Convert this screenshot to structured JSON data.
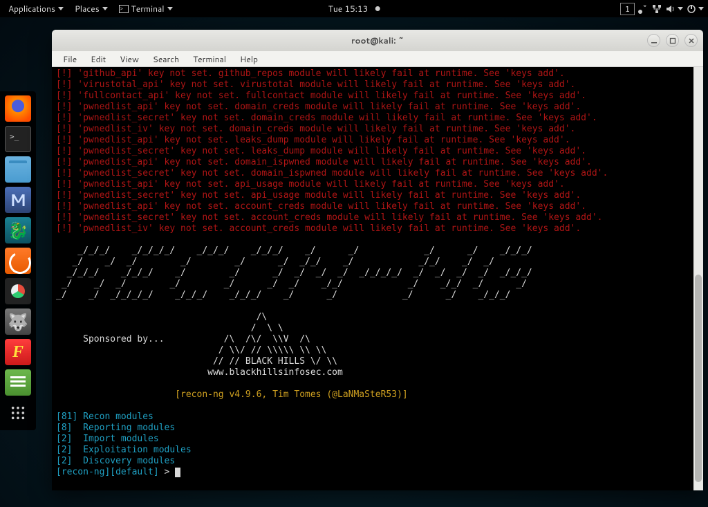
{
  "topbar": {
    "applications": "Applications",
    "places": "Places",
    "terminal_app": "Terminal",
    "clock": "Tue 15:13",
    "workspace": "1"
  },
  "window": {
    "title": "root@kali: ~",
    "menus": {
      "file": "File",
      "edit": "Edit",
      "view": "View",
      "search": "Search",
      "terminal": "Terminal",
      "help": "Help"
    }
  },
  "warnings": [
    "[!] 'github_api' key not set. github_repos module will likely fail at runtime. See 'keys add'.",
    "[!] 'virustotal_api' key not set. virustotal module will likely fail at runtime. See 'keys add'.",
    "[!] 'fullcontact_api' key not set. fullcontact module will likely fail at runtime. See 'keys add'.",
    "[!] 'pwnedlist_api' key not set. domain_creds module will likely fail at runtime. See 'keys add'.",
    "[!] 'pwnedlist_secret' key not set. domain_creds module will likely fail at runtime. See 'keys add'.",
    "[!] 'pwnedlist_iv' key not set. domain_creds module will likely fail at runtime. See 'keys add'.",
    "[!] 'pwnedlist_api' key not set. leaks_dump module will likely fail at runtime. See 'keys add'.",
    "[!] 'pwnedlist_secret' key not set. leaks_dump module will likely fail at runtime. See 'keys add'.",
    "[!] 'pwnedlist_api' key not set. domain_ispwned module will likely fail at runtime. See 'keys add'.",
    "[!] 'pwnedlist_secret' key not set. domain_ispwned module will likely fail at runtime. See 'keys add'.",
    "[!] 'pwnedlist_api' key not set. api_usage module will likely fail at runtime. See 'keys add'.",
    "[!] 'pwnedlist_secret' key not set. api_usage module will likely fail at runtime. See 'keys add'.",
    "[!] 'pwnedlist_api' key not set. account_creds module will likely fail at runtime. See 'keys add'.",
    "[!] 'pwnedlist_secret' key not set. account_creds module will likely fail at runtime. See 'keys add'.",
    "[!] 'pwnedlist_iv' key not set. account_creds module will likely fail at runtime. See 'keys add'."
  ],
  "ascii_banner": "    _/_/_/    _/_/_/_/    _/_/_/    _/_/_/    _/      _/            _/      _/    _/_/_/\n   _/    _/  _/        _/        _/      _/  _/_/    _/            _/_/    _/  _/       \n  _/_/_/    _/_/_/    _/        _/      _/  _/  _/  _/  _/_/_/_/  _/  _/  _/  _/  _/_/_/\n _/    _/  _/        _/        _/      _/  _/    _/_/            _/    _/_/  _/      _/ \n_/    _/  _/_/_/_/    _/_/_/    _/_/_/    _/      _/            _/      _/    _/_/_/    ",
  "sponsor": {
    "label": "Sponsored by...",
    "art": "                     /\\\n                    /  \\ \\\n               /\\  /\\/  \\\\V  /\\\n              / \\\\/ // \\\\\\\\\\ \\\\ \\\\\n             // // BLACK HILLS \\/ \\\\",
    "url": "www.blackhillsinfosec.com"
  },
  "version_line": "[recon-ng v4.9.6, Tim Tomes (@LaNMaSteR53)]",
  "modules": [
    {
      "count": "[81]",
      "label": "Recon modules"
    },
    {
      "count": "[8] ",
      "label": "Reporting modules"
    },
    {
      "count": "[2] ",
      "label": "Import modules"
    },
    {
      "count": "[2] ",
      "label": "Exploitation modules"
    },
    {
      "count": "[2] ",
      "label": "Discovery modules"
    }
  ],
  "prompt": {
    "context": "[recon-ng][default]",
    "symbol": " > "
  }
}
